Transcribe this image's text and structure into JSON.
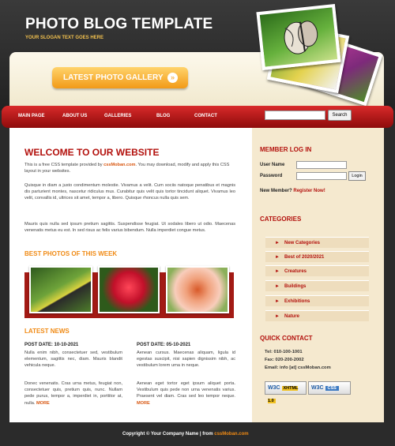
{
  "header": {
    "title": "PHOTO BLOG TEMPLATE",
    "slogan": "YOUR SLOGAN TEXT GOES HERE",
    "gallery_button": "LATEST PHOTO GALLERY"
  },
  "nav": {
    "items": [
      "MAIN PAGE",
      "ABOUT US",
      "GALLERIES",
      "BLOG",
      "CONTACT"
    ],
    "search_placeholder": "",
    "search_button": "Search"
  },
  "welcome": {
    "heading": "WELCOME TO OUR WEBSITE",
    "intro_part1": "This is a free CSS template provided by ",
    "intro_link": "cssMoban.com",
    "intro_part2": ". You may download, modify and apply this CSS layout in your websites.",
    "para2": "Quisque in diam a justo condimentum molestie. Vivamus a velit. Cum sociis natoque penatibus et magnis dis parturient montes, nascetur ridiculus mus. Curabitur quis velit quis tortor tincidunt aliquet. Vivamus leo velit, convallis id, ultrices sit amet, tempor a, libero. Quisque rhoncus nulla quis sem.",
    "para3": "Mauris quis nulla sed ipsum pretium sagittis. Suspendisse feugiat. Ut sodales libero ut odio. Maecenas venenatis metus eu est. In sed risus ac felis varius bibendum. Nulla imperdiet congue metus."
  },
  "best_photos": {
    "heading": "BEST PHOTOS OF THIS WEEK"
  },
  "news": {
    "heading": "LATEST NEWS",
    "posts": [
      {
        "date": "POST DATE: 10-10-2021",
        "text1": "Nulla enim nibh, consectetuer sed, vestibulum elementum, sagittis nec, diam. Mauris blandit vehicula neque.",
        "text2": "Donec venenatis. Cras urna metus, feugiat non, consectetuer quis, pretium quis, nunc. Nullam pede purus, tempor a, imperdiet in, porttitor at, nulla.",
        "more": "MORE"
      },
      {
        "date": "POST DATE: 05-10-2021",
        "text1": "Aenean cursus. Maecenas aliquam, ligula id egestas suscipit, nisi sapien dignissim nibh, ac vestibulum lorem urna in neque.",
        "text2": "Aenean eget tortor eget ipsum aliquet porta. Vestibulum quis pede non urna venenatis varius. Praesent vel diam. Cras sed leo tempor neque.",
        "more": "MORE"
      }
    ]
  },
  "member": {
    "heading": "MEMBER LOG IN",
    "user_label": "User Name",
    "password_label": "Password",
    "login_button": "Login",
    "new_member_text": "New Member?",
    "register_link": "Register Now!"
  },
  "categories": {
    "heading": "CATEGORIES",
    "items": [
      "New Categories",
      "Best of 2020/2021",
      "Creatures",
      "Buildings",
      "Exhibitions",
      "Nature"
    ]
  },
  "contact": {
    "heading": "QUICK CONTACT",
    "tel": "Tel: 010-100-1001",
    "fax": "Fax: 020-200-2002",
    "email": "Email: info [at] cssMoban.com"
  },
  "badges": {
    "xhtml_w3c": "W3C",
    "xhtml_label": "XHTML 1.0",
    "css_w3c": "W3C",
    "css_label": "CSS"
  },
  "footer": {
    "text": "Copyright © Your Company Name | from ",
    "link": "cssMoban.com"
  },
  "colors": {
    "accent_red": "#b3110d",
    "accent_orange": "#f08a14",
    "sidebar_bg": "#f5e9cf"
  }
}
